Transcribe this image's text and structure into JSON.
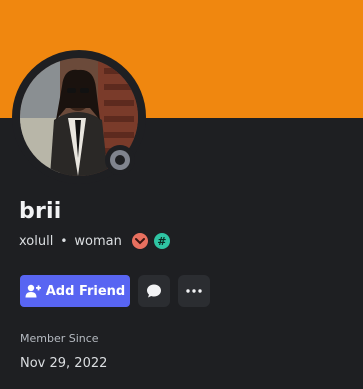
{
  "profile": {
    "banner_color": "#f0870f",
    "display_name": "brii",
    "username": "xolull",
    "separator": "•",
    "pronouns": "woman",
    "status": "offline",
    "badges": [
      {
        "icon": "heart-chevron-icon",
        "color": "#e8705f"
      },
      {
        "icon": "hashtag-icon",
        "color": "#2fc4a3",
        "glyph": "#"
      }
    ]
  },
  "actions": {
    "add_friend_label": "Add Friend",
    "add_friend_icon": "add-user-icon",
    "message_icon": "chat-bubble-icon",
    "more_icon": "ellipsis-icon"
  },
  "member_since": {
    "label": "Member Since",
    "date": "Nov 29, 2022"
  }
}
